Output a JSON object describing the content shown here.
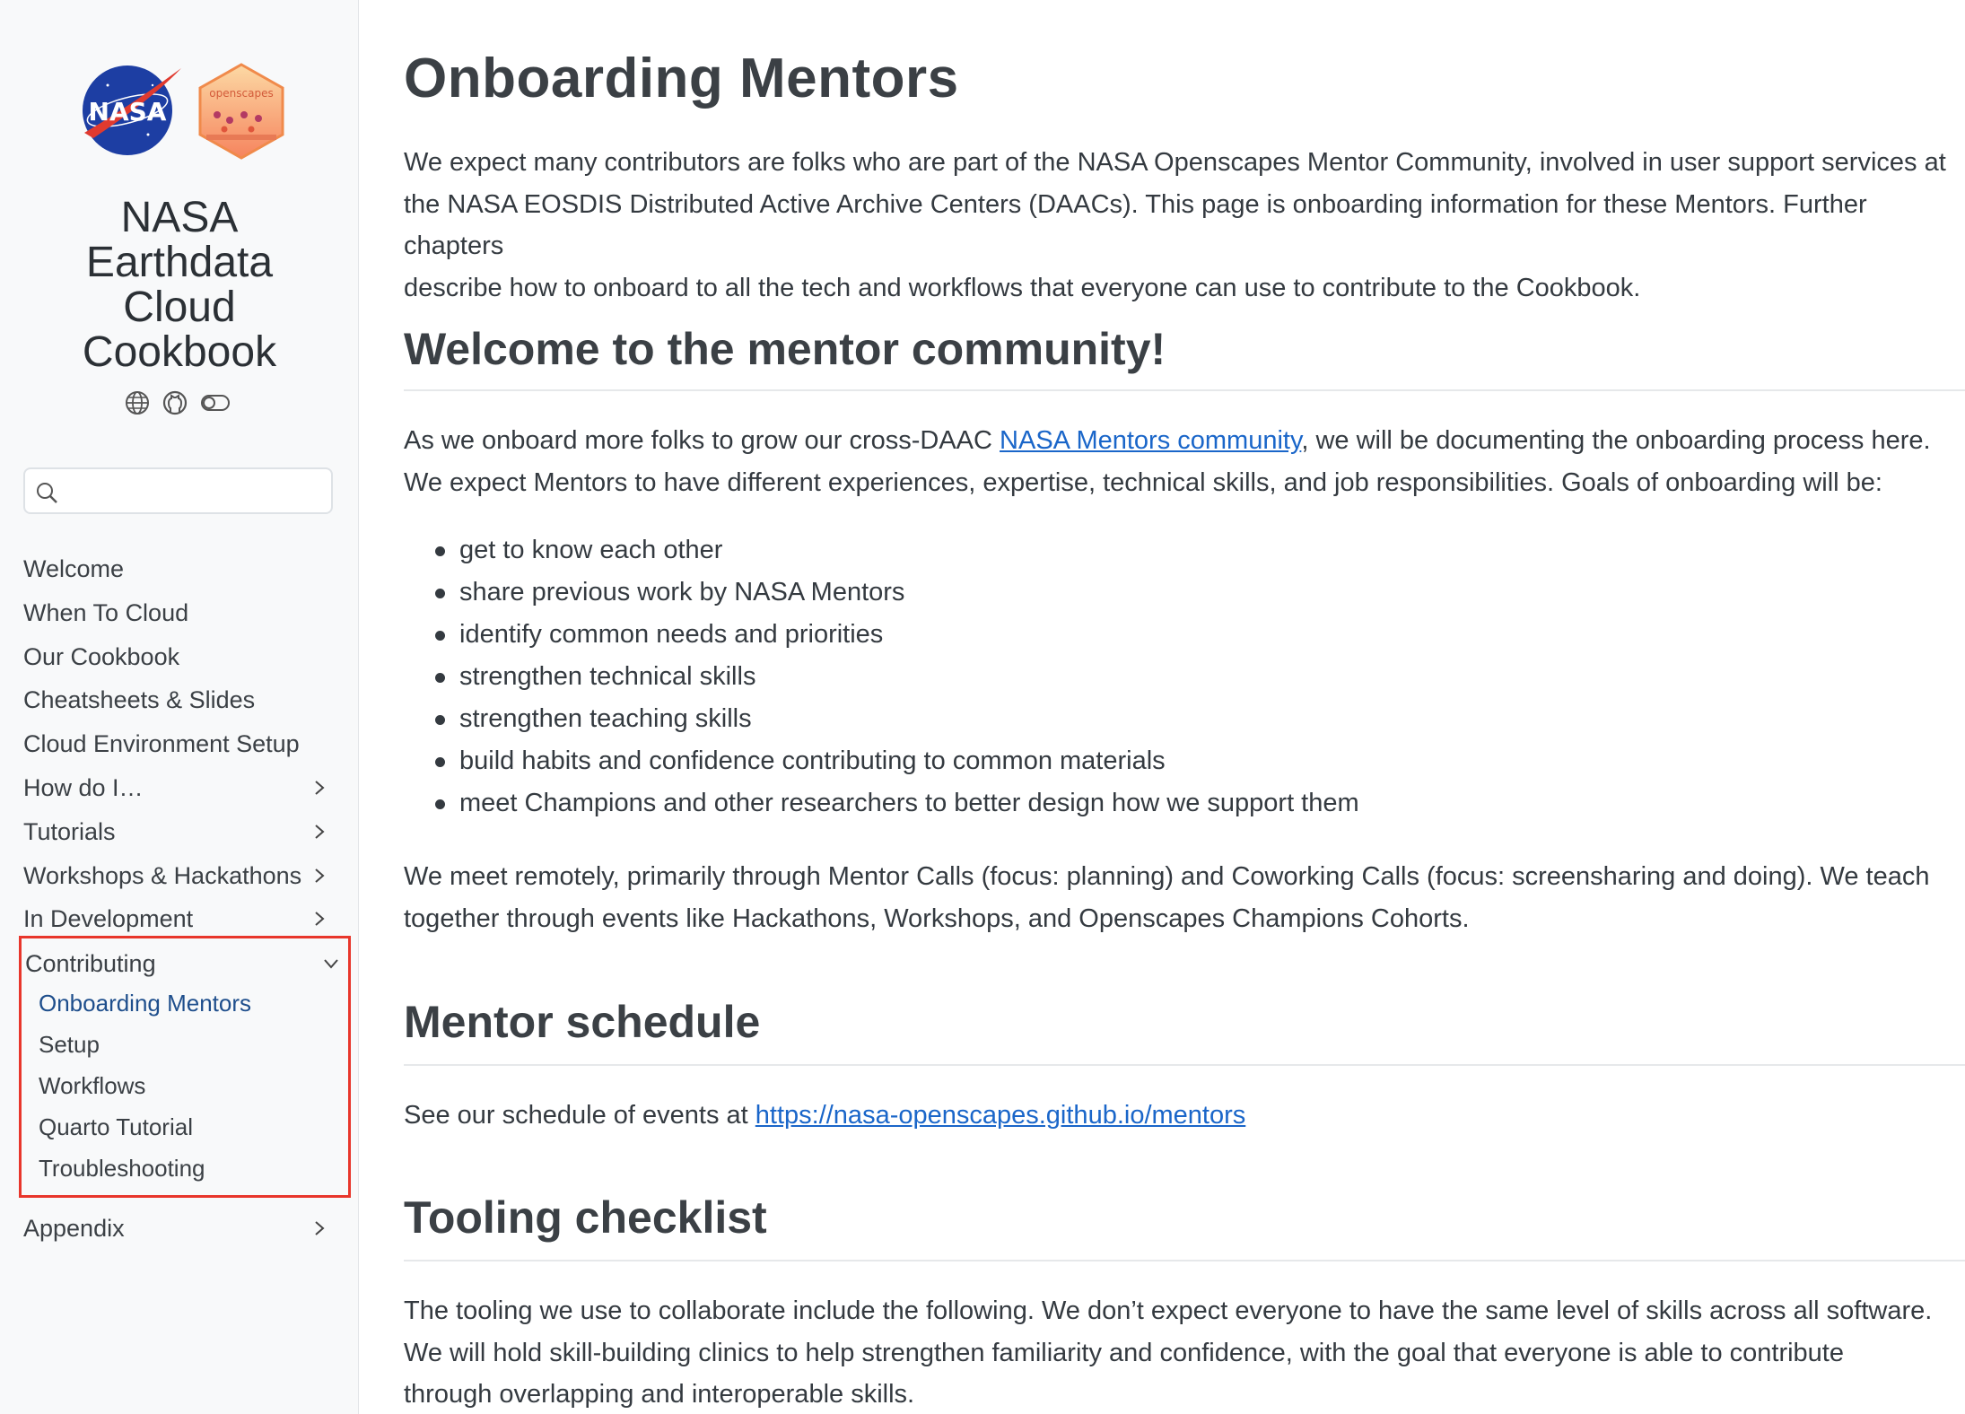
{
  "sidebar": {
    "logos": {
      "nasa_label": "NASA",
      "openscapes_label": "openscapes"
    },
    "title_lines": [
      "NASA",
      "Earthdata",
      "Cloud",
      "Cookbook"
    ],
    "tool_icons": [
      "globe-icon",
      "github-icon",
      "toggle-icon"
    ],
    "search": {
      "placeholder": ""
    },
    "nav_items": [
      {
        "label": "Welcome",
        "has_children": false
      },
      {
        "label": "When To Cloud",
        "has_children": false
      },
      {
        "label": "Our Cookbook",
        "has_children": false
      },
      {
        "label": "Cheatsheets & Slides",
        "has_children": false
      },
      {
        "label": "Cloud Environment Setup",
        "has_children": false
      },
      {
        "label": "How do I…",
        "has_children": true
      },
      {
        "label": "Tutorials",
        "has_children": true
      },
      {
        "label": "Workshops & Hackathons",
        "has_children": true
      },
      {
        "label": "In Development",
        "has_children": true
      }
    ],
    "contributing": {
      "label": "Contributing",
      "items": [
        {
          "label": "Onboarding Mentors",
          "active": true
        },
        {
          "label": "Setup",
          "active": false
        },
        {
          "label": "Workflows",
          "active": false
        },
        {
          "label": "Quarto Tutorial",
          "active": false
        },
        {
          "label": "Troubleshooting",
          "active": false
        }
      ]
    },
    "appendix": {
      "label": "Appendix"
    }
  },
  "main": {
    "title": "Onboarding Mentors",
    "intro_lines": [
      "We expect many contributors are folks who are part of the NASA Openscapes Mentor Community, involved in user support services at",
      "the NASA EOSDIS Distributed Active Archive Centers (DAACs). This page is onboarding information for these Mentors. Further chapters",
      "describe how to onboard to all the tech and workflows that everyone can use to contribute to the Cookbook."
    ],
    "section_welcome": {
      "heading": "Welcome to the mentor community!",
      "p1_before": "As we onboard more folks to grow our cross-DAAC ",
      "p1_link": "NASA Mentors community",
      "p1_after": ", we will be documenting the onboarding process here.",
      "p1_line2": "We expect Mentors to have different experiences, expertise, technical skills, and job responsibilities. Goals of onboarding will be:",
      "bullets": [
        "get to know each other",
        "share previous work by NASA Mentors",
        "identify common needs and priorities",
        "strengthen technical skills",
        "strengthen teaching skills",
        "build habits and confidence contributing to common materials",
        "meet Champions and other researchers to better design how we support them"
      ],
      "p2_lines": [
        "We meet remotely, primarily through Mentor Calls (focus: planning) and Coworking Calls (focus: screensharing and doing). We teach",
        "together through events like Hackathons, Workshops, and Openscapes Champions Cohorts."
      ]
    },
    "section_schedule": {
      "heading": "Mentor schedule",
      "text_before": "See our schedule of events at ",
      "link": "https://nasa-openscapes.github.io/mentors"
    },
    "section_tooling": {
      "heading": "Tooling checklist",
      "lines": [
        "The tooling we use to collaborate include the following. We don’t expect everyone to have the same level of skills across all software.",
        "We will hold skill-building clinics to help strengthen familiarity and confidence, with the goal that everyone is able to contribute",
        "through overlapping and interoperable skills."
      ]
    }
  },
  "colors": {
    "sidebar_bg": "#f8f9fa",
    "link": "#1a66c9",
    "active_nav": "#1e4e8c",
    "highlight_box": "#e8362b",
    "heading": "#3b4045"
  }
}
